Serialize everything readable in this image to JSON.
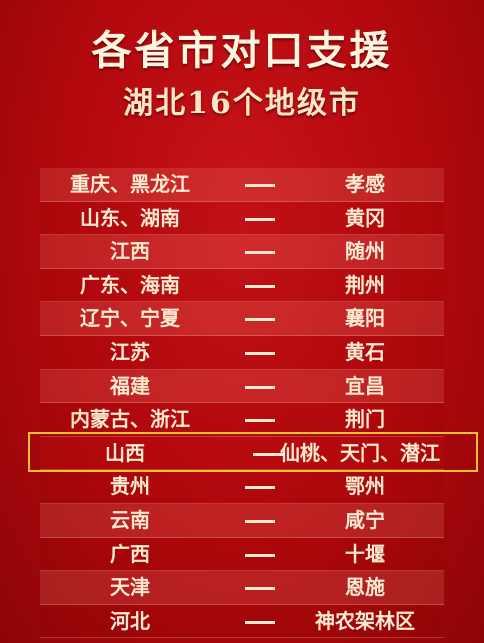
{
  "header": {
    "title": "各省市对口支援",
    "subtitle": "湖北16个地级市"
  },
  "colors": {
    "background": "#b3070c",
    "text": "#fbead0",
    "highlight_border": "#f2c230"
  },
  "rows": [
    {
      "province": "重庆、黑龙江",
      "city": "孝感"
    },
    {
      "province": "山东、湖南",
      "city": "黄冈"
    },
    {
      "province": "江西",
      "city": "随州"
    },
    {
      "province": "广东、海南",
      "city": "荆州"
    },
    {
      "province": "辽宁、宁夏",
      "city": "襄阳"
    },
    {
      "province": "江苏",
      "city": "黄石"
    },
    {
      "province": "福建",
      "city": "宜昌"
    },
    {
      "province": "内蒙古、浙江",
      "city": "荆门"
    },
    {
      "province": "山西",
      "city": "仙桃、天门、潜江",
      "highlighted": true
    },
    {
      "province": "贵州",
      "city": "鄂州"
    },
    {
      "province": "云南",
      "city": "咸宁"
    },
    {
      "province": "广西",
      "city": "十堰"
    },
    {
      "province": "天津",
      "city": "恩施"
    },
    {
      "province": "河北",
      "city": "神农架林区"
    }
  ]
}
